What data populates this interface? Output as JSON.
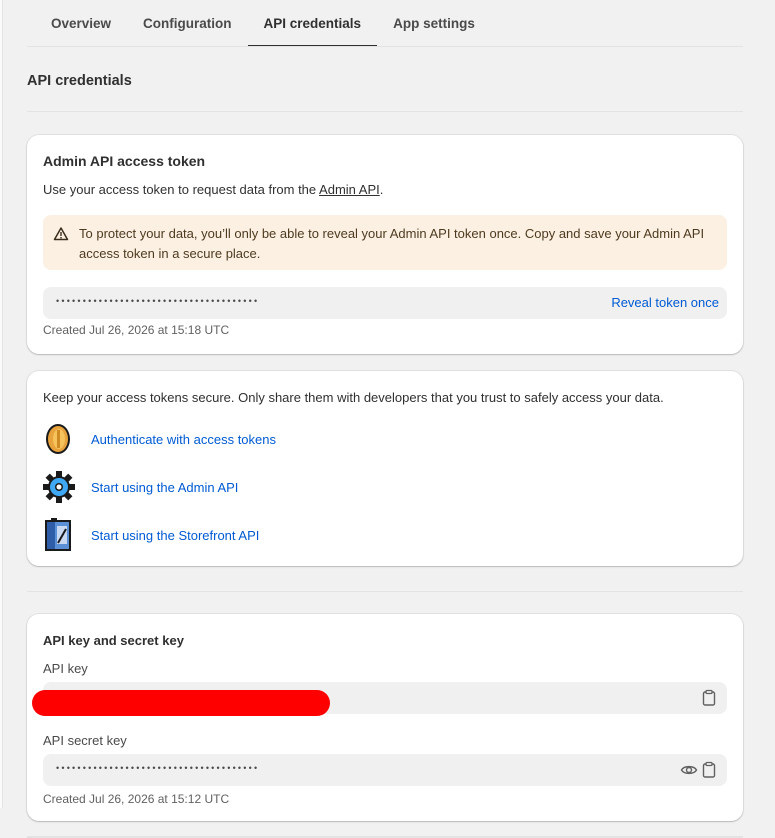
{
  "tabs": [
    {
      "label": "Overview"
    },
    {
      "label": "Configuration"
    },
    {
      "label": "API credentials"
    },
    {
      "label": "App settings"
    }
  ],
  "page": {
    "section_title": "API credentials"
  },
  "admin_token_card": {
    "title": "Admin API access token",
    "description_prefix": "Use your access token to request data from the ",
    "description_link": "Admin API",
    "description_suffix": ".",
    "banner_text": "To protect your data, you’ll only be able to reveal your Admin API token once. Copy and save your Admin API access token in a secure place.",
    "masked_value": "••••••••••••••••••••••••••••••••••••••",
    "reveal_label": "Reveal token once",
    "created": "Created Jul 26, 2026 at 15:18 UTC"
  },
  "security_card": {
    "intro": "Keep your access tokens secure. Only share them with developers that you trust to safely access your data.",
    "resources": [
      {
        "label": "Authenticate with access tokens",
        "icon": "coin-icon"
      },
      {
        "label": "Start using the Admin API",
        "icon": "gear-icon"
      },
      {
        "label": "Start using the Storefront API",
        "icon": "storefront-book-icon"
      }
    ]
  },
  "keys_card": {
    "title": "API key and secret key",
    "api_key_label": "API key",
    "secret_label": "API secret key",
    "secret_masked": "••••••••••••••••••••••••••••••••••••••",
    "created": "Created Jul 26, 2026 at 15:12 UTC"
  },
  "colors": {
    "link": "#005bd3",
    "banner_bg": "#fcf0e3",
    "redaction": "#ff0000"
  }
}
